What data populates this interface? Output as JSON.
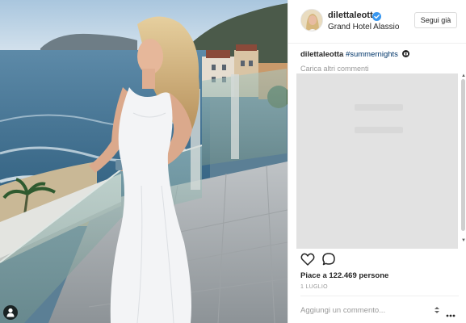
{
  "post": {
    "username": "dilettaleotta",
    "verified": true,
    "location": "Grand Hotel Alassio",
    "follow_label": "Segui già",
    "caption": {
      "user": "dilettaleotta",
      "hashtag": "#summernights",
      "icon": "camera-icon"
    },
    "load_more": "Carica altri commenti",
    "likes": "Piace a 122.469 persone",
    "date": "1 LUGLIO",
    "comment_placeholder": "Aggiungi un commento...",
    "icons": {
      "like": "heart-icon",
      "comment": "comment-bubble-icon",
      "more": "more-options-icon",
      "verified": "verified-badge-icon",
      "user_tag": "user-tag-icon"
    }
  },
  "colors": {
    "accent_link": "#003569",
    "verified_blue": "#3897f0",
    "border": "#efefef",
    "muted_text": "#999999"
  }
}
